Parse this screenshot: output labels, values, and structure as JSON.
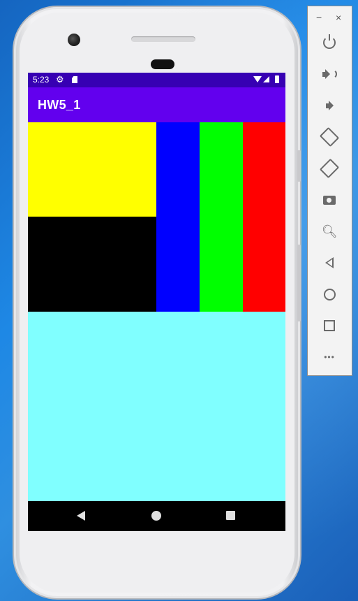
{
  "status_bar": {
    "time": "5:23",
    "gear_icon": "gear-icon",
    "sd_icon": "sd-card-icon"
  },
  "app": {
    "title": "HW5_1"
  },
  "blocks": {
    "yellow": "#ffff00",
    "black": "#000000",
    "blue": "#0000ff",
    "green": "#00ff00",
    "red": "#ff0000",
    "cyan": "#80ffff"
  },
  "colors": {
    "status_bar": "#3700b3",
    "app_bar": "#6200ee"
  },
  "nav_bar": {
    "icons": [
      "back-icon",
      "home-icon",
      "recents-icon"
    ]
  },
  "emulator_toolbar": {
    "minimize": "−",
    "close": "×",
    "buttons": [
      "power-icon",
      "volume-up-icon",
      "volume-down-icon",
      "rotate-left-icon",
      "rotate-right-icon",
      "camera-icon",
      "zoom-icon",
      "back-icon",
      "home-icon",
      "overview-icon",
      "more-icon"
    ],
    "more_label": "•••"
  }
}
